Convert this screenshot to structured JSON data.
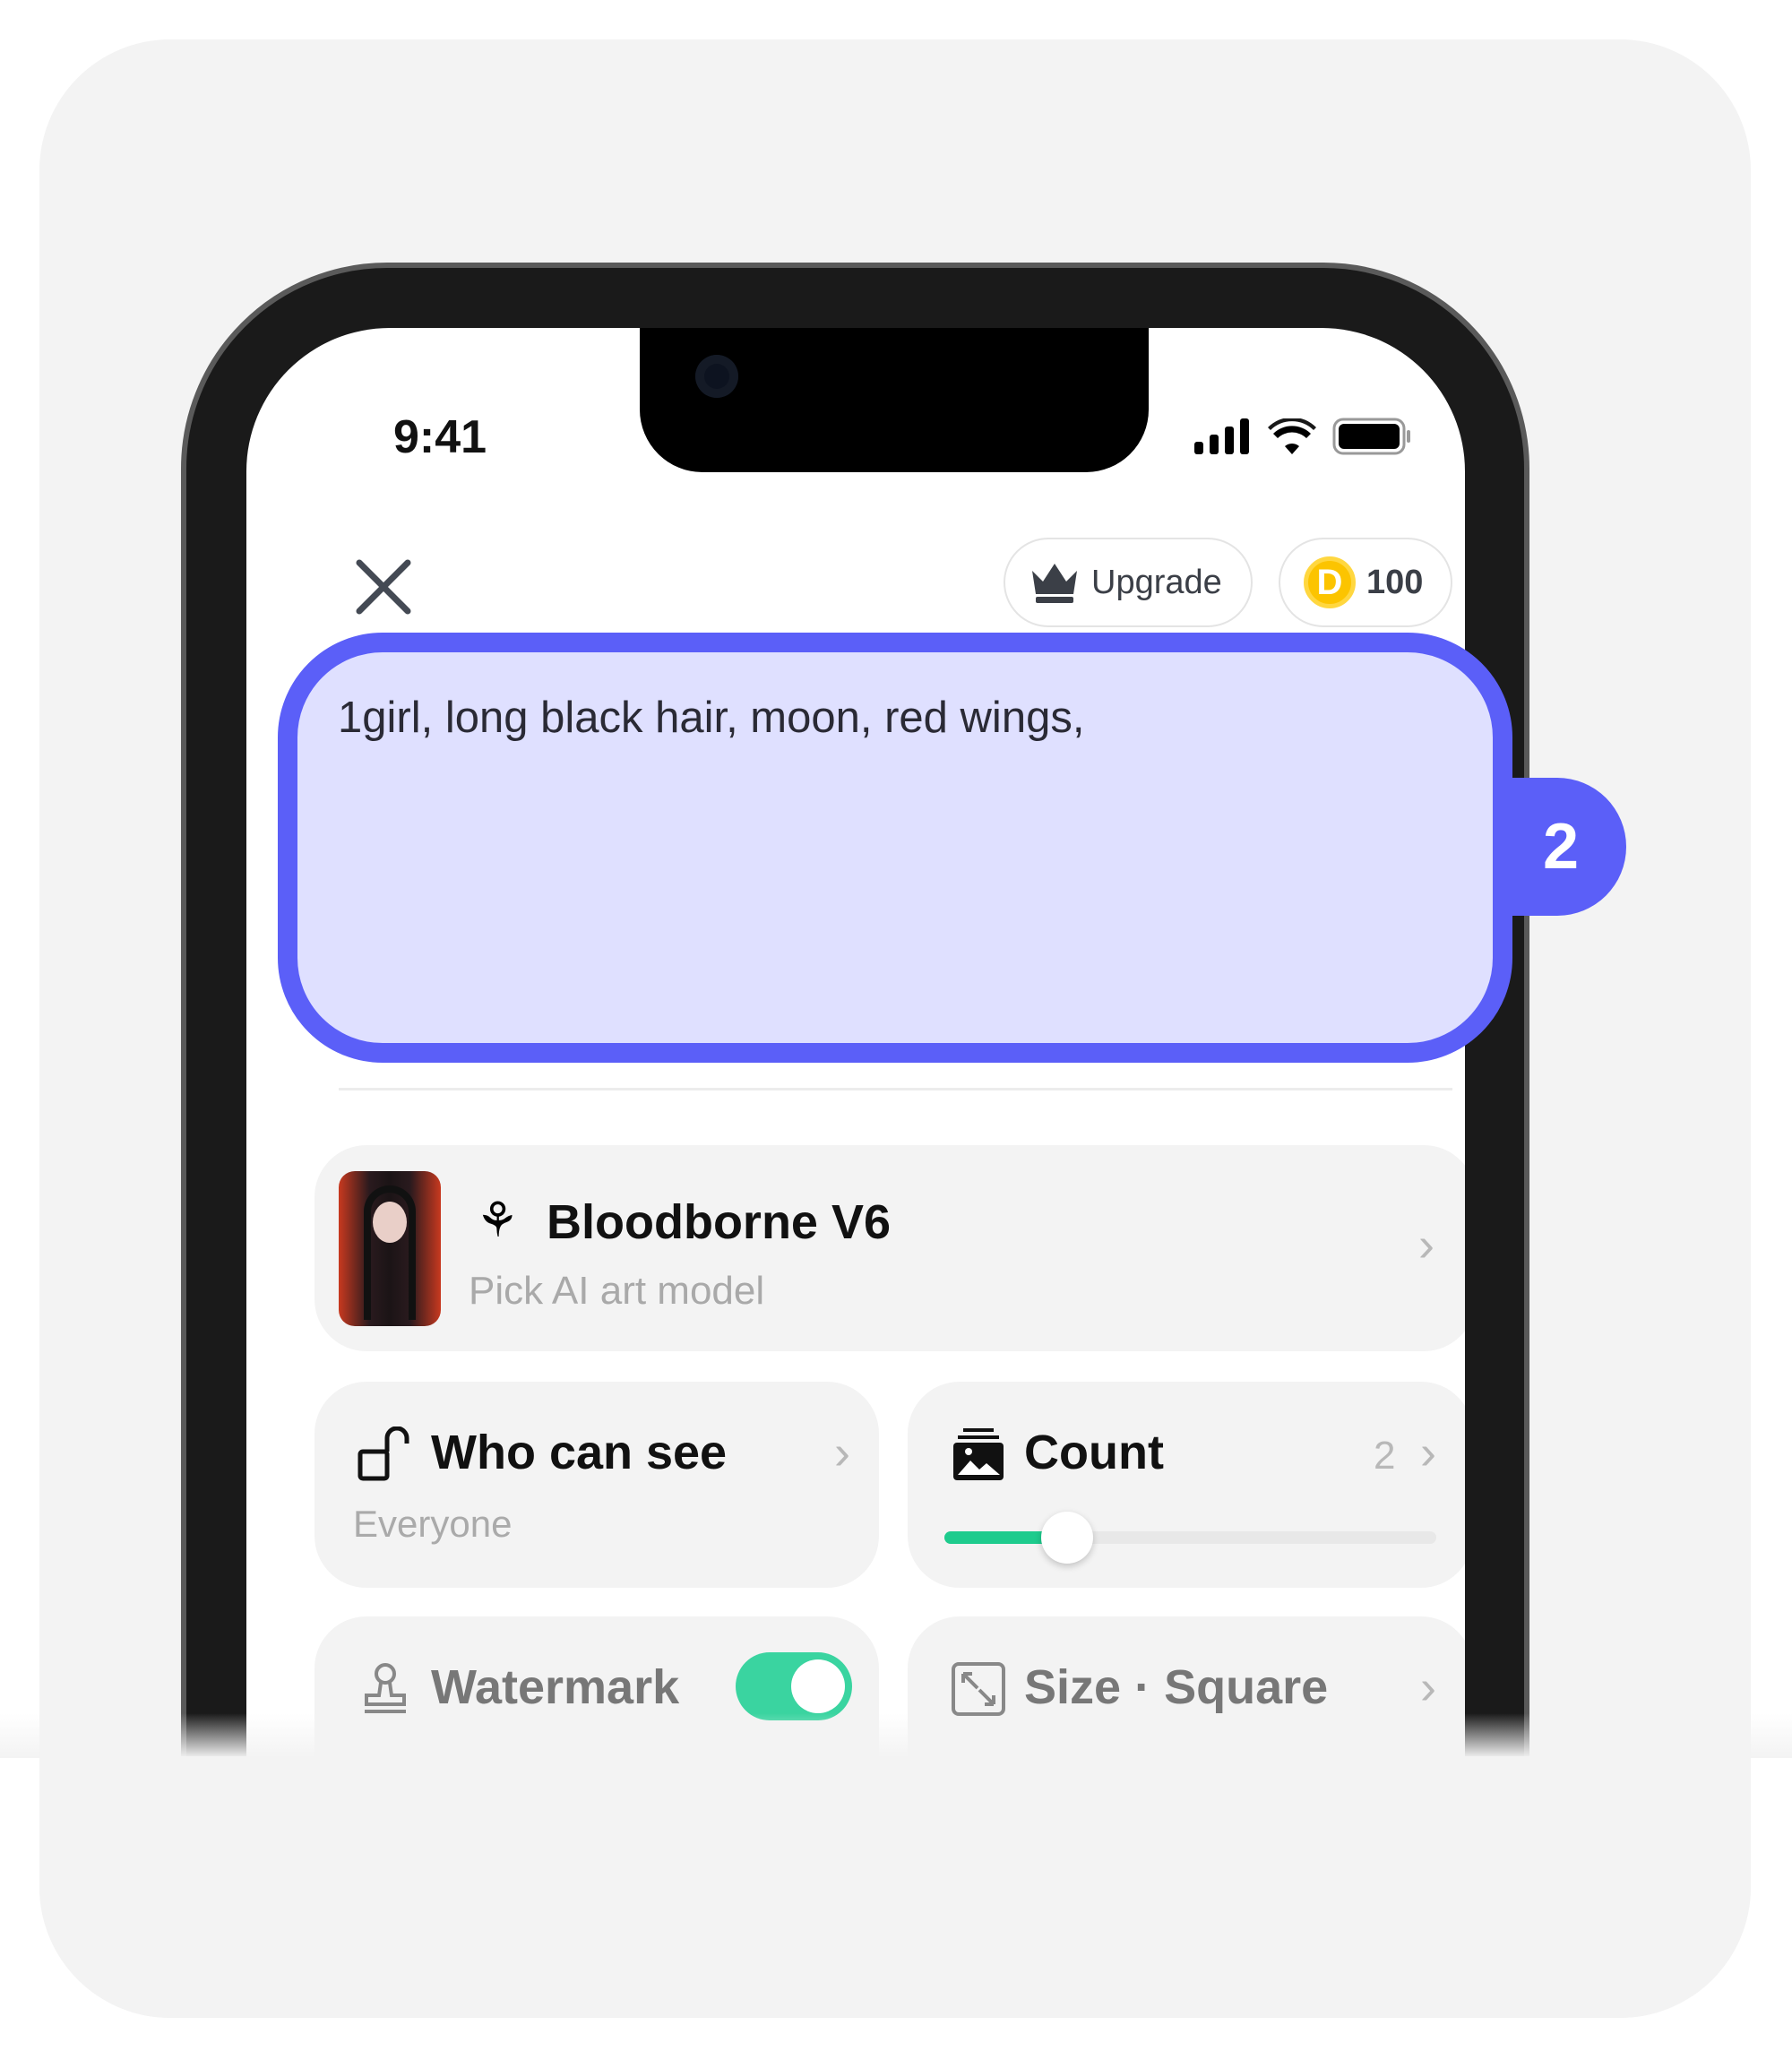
{
  "status_bar": {
    "time": "9:41"
  },
  "header": {
    "upgrade_label": "Upgrade",
    "coin_symbol": "D",
    "coin_balance": "100"
  },
  "prompt": {
    "text": "1girl, long black hair, moon, red wings,",
    "highlight_badge": "2"
  },
  "model": {
    "name": "Bloodborne V6",
    "subtitle": "Pick AI art model"
  },
  "visibility": {
    "title": "Who can see",
    "value": "Everyone"
  },
  "count": {
    "title": "Count",
    "value": "2",
    "slider_fraction": 0.25
  },
  "watermark": {
    "title": "Watermark",
    "enabled": true
  },
  "size": {
    "title": "Size",
    "separator": "·",
    "value": "Square"
  },
  "colors": {
    "highlight": "#5b5ff8",
    "highlight_fill": "#dfe0ff",
    "accent": "#1ecb8d",
    "coin": "#fcc400"
  }
}
